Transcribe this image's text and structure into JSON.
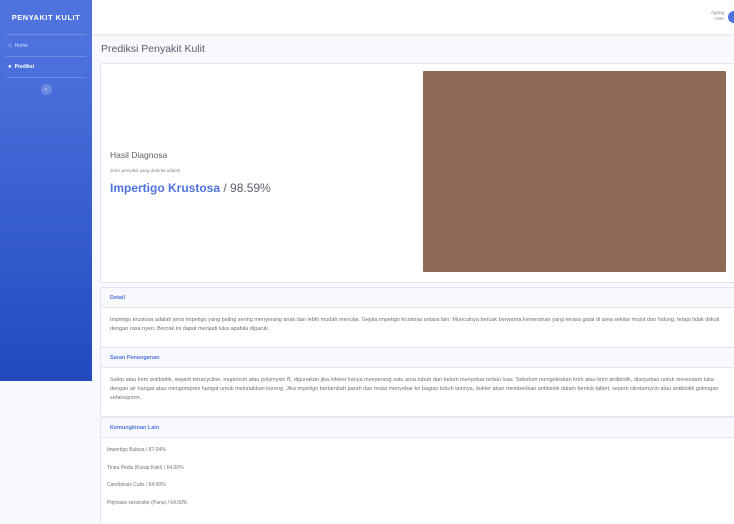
{
  "sidebar": {
    "brand": "PENYAKIT KULIT",
    "items": [
      {
        "label": "Home",
        "active": false
      },
      {
        "label": "Prediksi",
        "active": true
      }
    ]
  },
  "topbar": {
    "user_line1": "Agung",
    "user_line2": "User"
  },
  "page_title": "Prediksi Penyakit Kulit",
  "hasil": {
    "title": "Hasil Diagnosa",
    "subtitle": "Jenis penyakit yang diderita adalah",
    "disease": "Impertigo Krustosa",
    "percent": " / 98.59%"
  },
  "detail": {
    "header": "Detail",
    "text": "Impetigo krustosa adalah jenis impetigo yang paling sering menyerang anak dan lebih mudah menular. Gejala impetigo krustosa antara lain: Munculnya bercak berwarna kemerahan yang terasa gatal di area sekitar mulut dan hidung, tetapi tidak diikuti dengan rasa nyeri. Bercak ini dapat menjadi luka apabila digaruk."
  },
  "saran": {
    "header": "Saran Penanganan",
    "text": "Salep atau krim antibiotik, seperti tetracycline, mupirocin atau polymyxin B, digunakan jika infeksi hanya menyerang satu area tubuh dan belum menyebar terlalu luas. Sebelum mengoleskan krim atau krim antibiotik, dianjurkan untuk merendam luka dengan air hangat atau mengompres hangat untuk melunakkan koreng. Jika impetigo bertambah parah dan mulai menyebar ke bagian tubuh lainnya, dokter akan memberikan antibiotik dalam bentuk tablet, seperti clindamycin atau antibiotik golongan sefalosporin."
  },
  "lain": {
    "header": "Kemungkinan Lain",
    "items": [
      "Impertigo Bulosa / 87.04%",
      "Tinea Pedis (Kurap Kaki) / 64.00%",
      "Candidosis Cutis / 64.00%",
      "Pityriasis versicolor (Panu) / 64.00%"
    ]
  }
}
